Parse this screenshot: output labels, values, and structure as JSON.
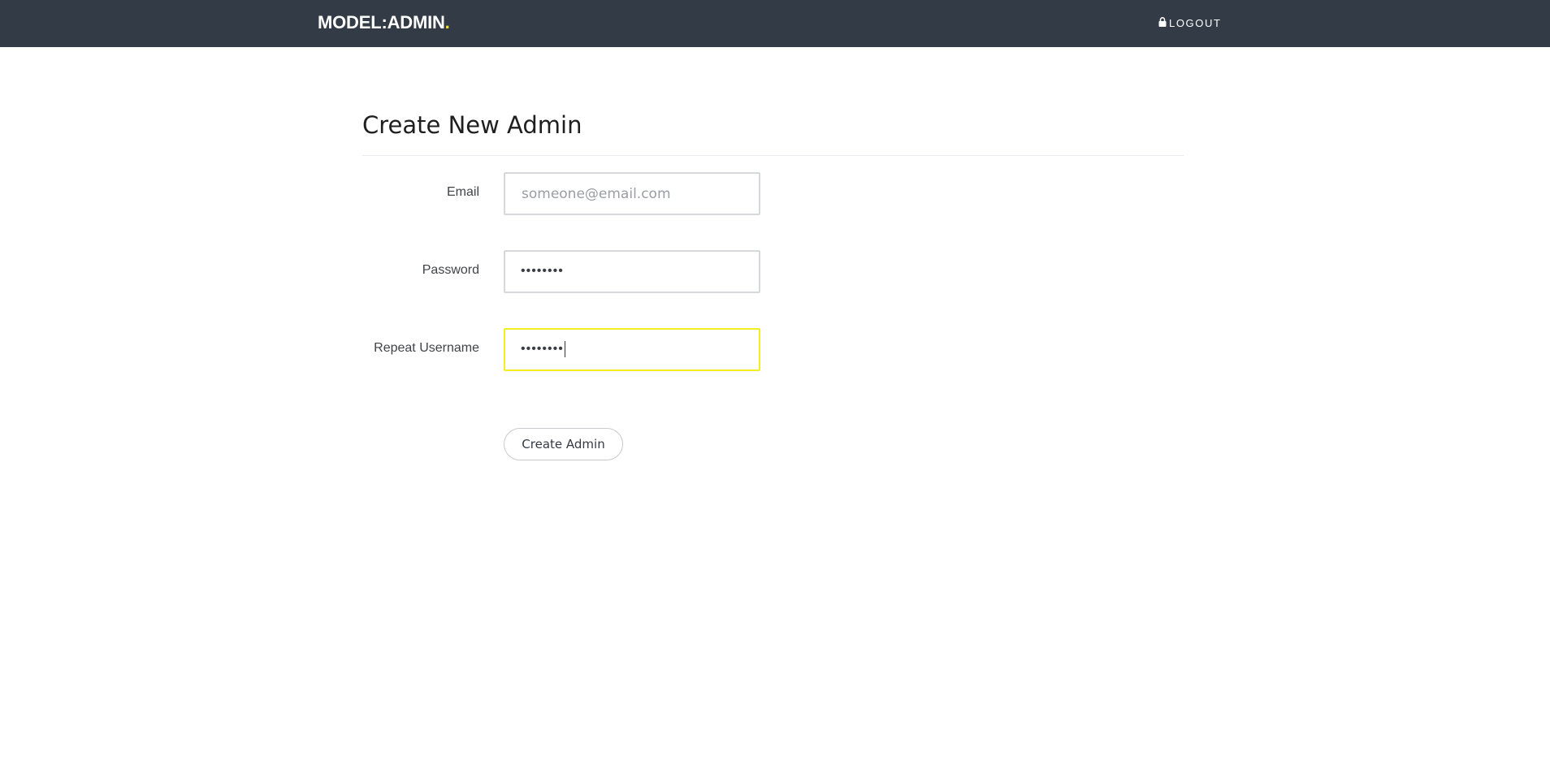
{
  "header": {
    "brand_text": "MODEL:ADMIN",
    "brand_dot": ".",
    "logout_label": "LOGOUT",
    "logout_icon": "lock-icon",
    "brand_accent_color": "#f5e11a",
    "background_color": "#323b46"
  },
  "page": {
    "title": "Create New Admin"
  },
  "form": {
    "email": {
      "label": "Email",
      "placeholder": "someone@email.com",
      "value": ""
    },
    "password": {
      "label": "Password",
      "masked_value": "••••••••"
    },
    "repeat": {
      "label": "Repeat Username",
      "masked_value": "••••••••",
      "focused": true,
      "focus_color": "#f1ee21"
    },
    "submit_label": "Create Admin"
  }
}
